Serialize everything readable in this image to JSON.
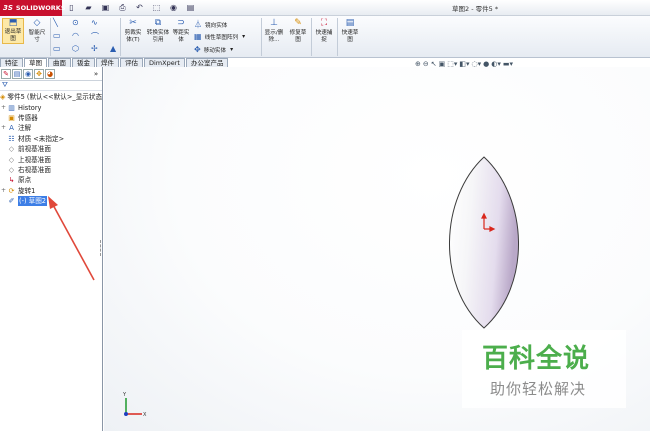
{
  "app": {
    "brand_ds": "3S",
    "brand_name": "SOLIDWORKS",
    "window_title": "草图2 - 零件5 *"
  },
  "quick_access": [
    "new-icon",
    "open-icon",
    "save-icon",
    "print-icon",
    "undo-icon",
    "select-icon",
    "rebuild-icon",
    "options-icon"
  ],
  "ribbon": {
    "exit_sketch": "退出草图",
    "smart_dimension": "智能尺寸",
    "trim_entities": "剪裁实体(T)",
    "convert_entities": "转换实体引用",
    "offset_entities": "等距实体",
    "mirror_entities": "镜向实体",
    "linear_pattern": "线性草图阵列",
    "move_entities": "移动实体",
    "display_delete": "显示/删除...",
    "repair_sketch": "修复草图",
    "quick_snaps": "快速捕捉",
    "rapid_sketch": "快速草图"
  },
  "tabs": [
    {
      "label": "特征",
      "active": false
    },
    {
      "label": "草图",
      "active": true
    },
    {
      "label": "曲面",
      "active": false
    },
    {
      "label": "钣金",
      "active": false
    },
    {
      "label": "焊件",
      "active": false
    },
    {
      "label": "评估",
      "active": false
    },
    {
      "label": "DimXpert",
      "active": false
    },
    {
      "label": "办公室产品",
      "active": false
    }
  ],
  "feature_tree": {
    "root": "零件5 (默认<<默认>_显示状态",
    "items": [
      {
        "label": "History",
        "icon": "history-icon"
      },
      {
        "label": "传感器",
        "icon": "sensor-icon"
      },
      {
        "label": "注解",
        "icon": "annotation-icon"
      },
      {
        "label": "材质 <未指定>",
        "icon": "material-icon"
      },
      {
        "label": "前视基准面",
        "icon": "plane-icon"
      },
      {
        "label": "上视基准面",
        "icon": "plane-icon"
      },
      {
        "label": "右视基准面",
        "icon": "plane-icon"
      },
      {
        "label": "原点",
        "icon": "origin-icon"
      },
      {
        "label": "旋转1",
        "icon": "revolve-icon"
      },
      {
        "label": "(-) 草图2",
        "icon": "sketch-icon",
        "selected": true
      }
    ]
  },
  "watermark": {
    "title": "百科全说",
    "subtitle": "助你轻松解决"
  },
  "colors": {
    "brand_red": "#c8102e",
    "selection_blue": "#3d7ee6",
    "arrow_red": "#e0483a",
    "watermark_green": "#4cae4c"
  }
}
